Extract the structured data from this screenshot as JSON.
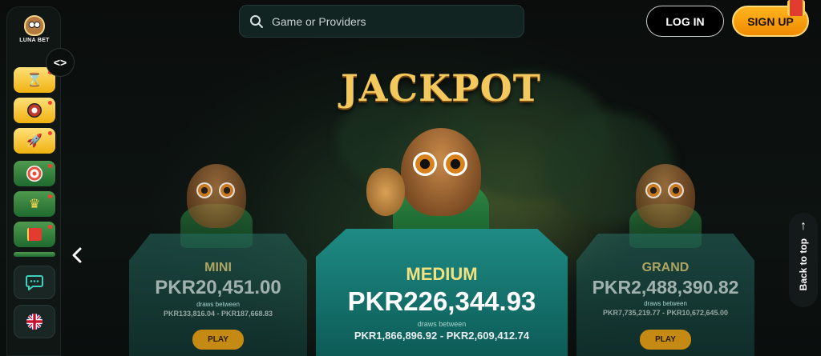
{
  "brand": {
    "logo_text": "LUNA BET"
  },
  "header": {
    "search_placeholder": "Game or Providers",
    "login_label": "LOG IN",
    "signup_label": "SIGN UP"
  },
  "sidebar": {
    "toggle_symbol": "<>",
    "games": [
      {
        "icon": "hourglass-icon"
      },
      {
        "icon": "roulette-icon"
      },
      {
        "icon": "rocket-icon"
      },
      {
        "icon": "target-icon"
      },
      {
        "icon": "crown-icon"
      },
      {
        "icon": "gift-icon"
      }
    ],
    "chat_icon": "chat-icon",
    "language_icon": "uk-flag-icon"
  },
  "jackpot": {
    "title": "JACKPOT",
    "tiers": [
      {
        "level": "MINI",
        "amount": "PKR20,451.00",
        "between_label": "draws between",
        "range": "PKR133,816.04 - PKR187,668.83",
        "play_label": "PLAY"
      },
      {
        "level": "MEDIUM",
        "amount": "PKR226,344.93",
        "between_label": "draws between",
        "range": "PKR1,866,896.92 - PKR2,609,412.74"
      },
      {
        "level": "GRAND",
        "amount": "PKR2,488,390.82",
        "between_label": "draws between",
        "range": "PKR7,735,219.77 - PKR10,672,645.00",
        "play_label": "PLAY"
      }
    ]
  },
  "back_to_top_label": "Back to top",
  "colors": {
    "accent": "#f08a00",
    "card_teal": "#1e8b84",
    "gold_text": "#f2e27f"
  }
}
